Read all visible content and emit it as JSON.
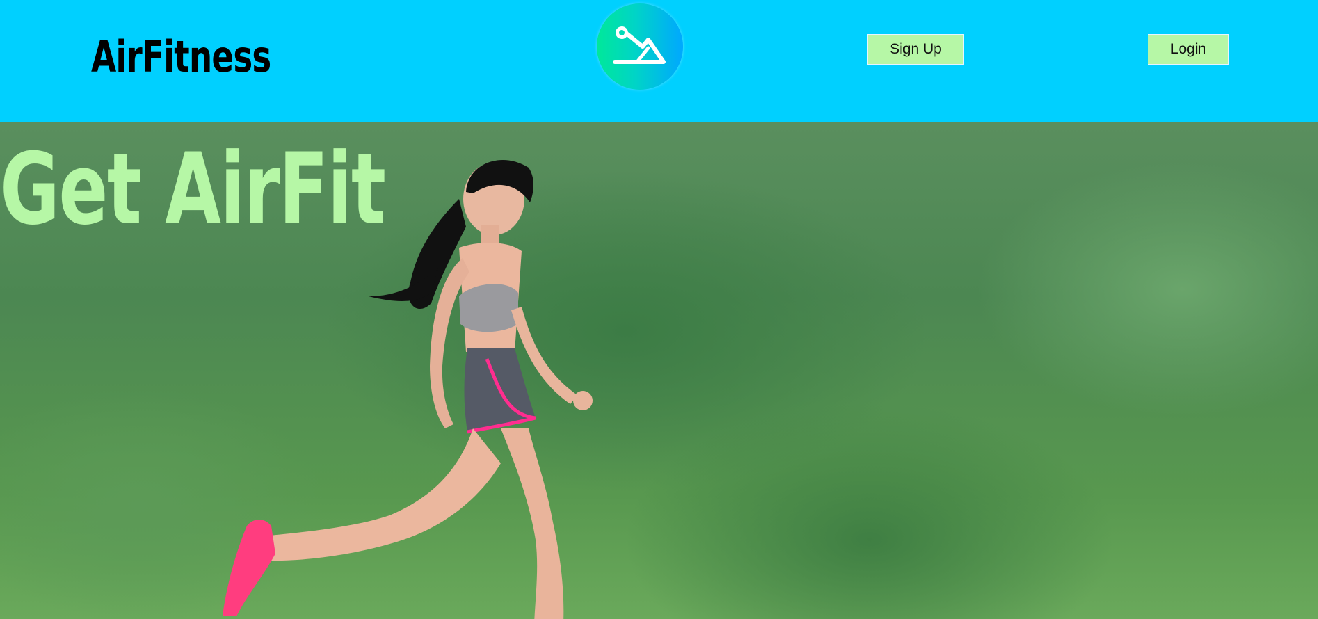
{
  "header": {
    "brand": "AirFitness",
    "logo_icon": "fitness-logo-icon",
    "signup_label": "Sign Up",
    "login_label": "Login"
  },
  "hero": {
    "title": "Get AirFit",
    "image": "woman-running-photo"
  },
  "colors": {
    "header_bg": "#00d0ff",
    "accent_green": "#b6f7a6",
    "logo_gradient_start": "#00e89a",
    "logo_gradient_end": "#00a8ff"
  }
}
